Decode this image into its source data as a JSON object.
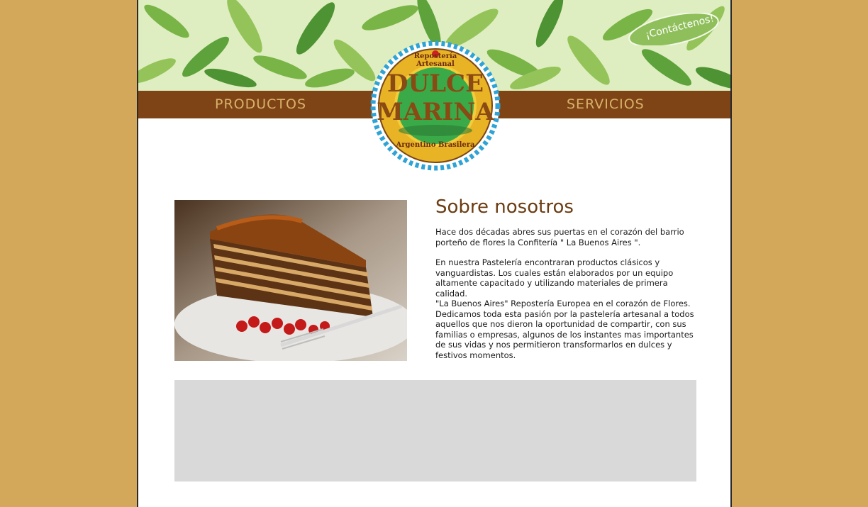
{
  "header": {
    "contact_label": "¡Contáctenos!",
    "nav": {
      "productos": "PRODUCTOS",
      "servicios": "SERVICIOS"
    },
    "logo": {
      "top_text": "Repostería Artesanal",
      "name_line1": "DULCE",
      "name_line2": "MARINA",
      "bottom_text": "Argentino Brasilera"
    }
  },
  "about": {
    "title": "Sobre nosotros",
    "paragraphs": [
      "Hace dos décadas abres sus puertas en el corazón del barrio porteño de flores la Confitería \" La Buenos Aires \".",
      "En nuestra Pastelería encontraran productos clásicos y vanguardistas. Los cuales están elaborados por un equipo altamente capacitado y utilizando materiales de primera calidad.",
      "\"La Buenos Aires\" Repostería Europea en el corazón de Flores. Dedicamos toda esta pasión por la pastelería artesanal a todos aquellos que nos dieron la oportunidad de compartir, con sus familias o empresas, algunos de los instantes mas importantes de sus vidas y nos permitieron transformarlos en dulces y festivos momentos."
    ]
  },
  "colors": {
    "background": "#d4a85a",
    "navbar": "#7e4416",
    "nav_text": "#d9b26a",
    "title": "#6b3c12",
    "placeholder_box": "#d9d9d9"
  }
}
